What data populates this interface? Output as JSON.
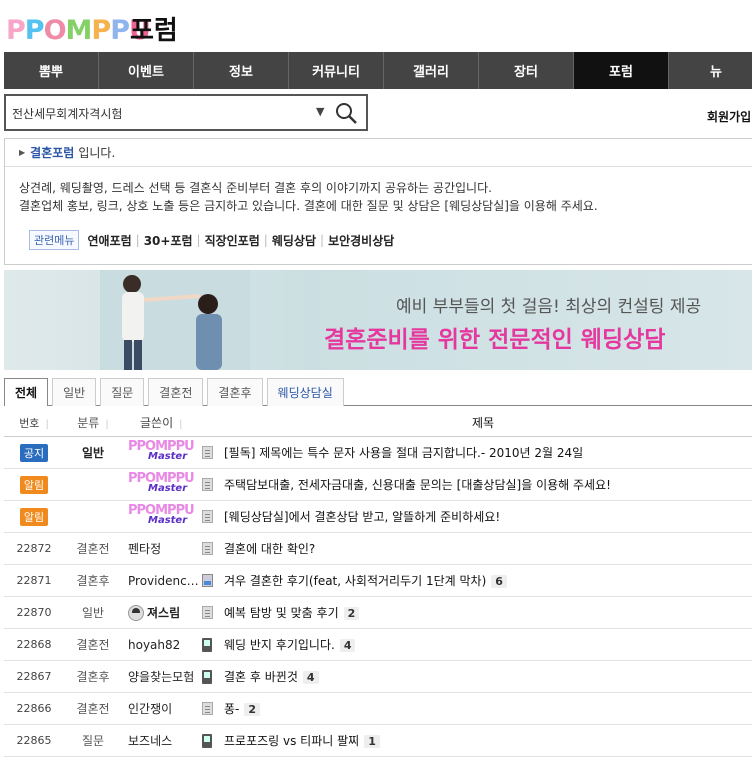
{
  "header": {
    "logo_letters": [
      "P",
      "P",
      "O",
      "M",
      "P",
      "P",
      "U"
    ],
    "forum_title": "포럼"
  },
  "nav": {
    "items": [
      {
        "label": "뽐뿌",
        "active": false
      },
      {
        "label": "이벤트",
        "active": false
      },
      {
        "label": "정보",
        "active": false
      },
      {
        "label": "커뮤니티",
        "active": false
      },
      {
        "label": "갤러리",
        "active": false
      },
      {
        "label": "장터",
        "active": false
      },
      {
        "label": "포럼",
        "active": true
      },
      {
        "label": "뉴",
        "active": false
      }
    ]
  },
  "search": {
    "value": "전산세무회계자격시험",
    "arrow": "▼"
  },
  "account": {
    "signup_label": "회원가입"
  },
  "info": {
    "forum_name": "결혼포럼",
    "forum_suffix": "입니다.",
    "desc_line1": "상견례, 웨딩촬영, 드레스 선택 등 결혼식 준비부터 결혼 후의 이야기까지 공유하는 공간입니다.",
    "desc_line2": "결혼업체 홍보, 링크, 상호 노출 등은 금지하고 있습니다. 결혼에 대한 질문 및 상담은 [웨딩상담실]을 이용해 주세요.",
    "related_label": "관련메뉴",
    "related_links": [
      "연애포럼",
      "30+포럼",
      "직장인포럼",
      "웨딩상담",
      "보안경비상담"
    ]
  },
  "banner": {
    "sub": "예비 부부들의 첫 걸음! 최상의 컨설팅 제공",
    "main": "결혼준비를 위한 전문적인 웨딩상담"
  },
  "tabs": [
    {
      "label": "전체",
      "active": true
    },
    {
      "label": "일반",
      "active": false
    },
    {
      "label": "질문",
      "active": false
    },
    {
      "label": "결혼전",
      "active": false
    },
    {
      "label": "결혼후",
      "active": false
    },
    {
      "label": "웨딩상담실",
      "active": false
    }
  ],
  "table": {
    "headers": {
      "num": "번호",
      "cat": "분류",
      "author": "글쓴이",
      "title": "제목"
    },
    "notices": [
      {
        "badge": "공지",
        "badge_type": "notice",
        "cat": "일반",
        "author_logo": "PPOMPPU",
        "author_sub": "Master",
        "title": "[필독] 제목에는 특수 문자 사용을 절대 금지합니다.- 2010년 2월 24일"
      },
      {
        "badge": "알림",
        "badge_type": "alert",
        "cat": "",
        "author_logo": "PPOMPPU",
        "author_sub": "Master",
        "title": "주택담보대출, 전세자금대출, 신용대출 문의는 [대출상담실]을 이용해 주세요!"
      },
      {
        "badge": "알림",
        "badge_type": "alert",
        "cat": "",
        "author_logo": "PPOMPPU",
        "author_sub": "Master",
        "title": "[웨딩상담실]에서 결혼상담 받고, 알뜰하게 준비하세요!"
      }
    ],
    "rows": [
      {
        "num": "22872",
        "cat": "결혼전",
        "author": "펜타정",
        "icon": "doc",
        "title": "결혼에 대한 확인?",
        "comments": ""
      },
      {
        "num": "22871",
        "cat": "결혼후",
        "author": "Providenc…",
        "icon": "image",
        "title": "겨우 결혼한 후기(feat, 사회적거리두기 1단계 막차)",
        "comments": "6"
      },
      {
        "num": "22870",
        "cat": "일반",
        "author": "져스림",
        "icon": "doc",
        "title": "예복 탐방 및 맞춤 후기",
        "comments": "2",
        "avatar": true
      },
      {
        "num": "22868",
        "cat": "결혼전",
        "author": "hoyah82",
        "icon": "phone",
        "title": "웨딩 반지 후기입니다.",
        "comments": "4"
      },
      {
        "num": "22867",
        "cat": "결혼후",
        "author": "양을찾는모험",
        "icon": "phone",
        "title": "결혼 후 바뀐것",
        "comments": "4"
      },
      {
        "num": "22866",
        "cat": "결혼전",
        "author": "인간쟁이",
        "icon": "doc",
        "title": "퐁-",
        "comments": "2"
      },
      {
        "num": "22865",
        "cat": "질문",
        "author": "보즈네스",
        "icon": "phone",
        "title": "프로포즈링 vs 티파니 팔찌",
        "comments": "1"
      }
    ]
  }
}
